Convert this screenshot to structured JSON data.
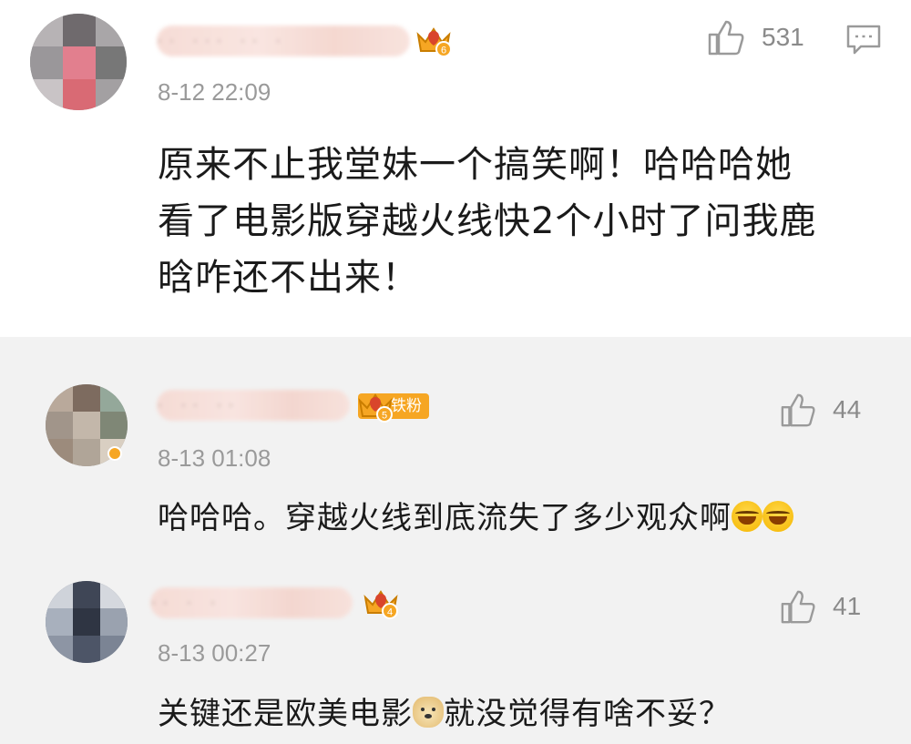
{
  "main": {
    "time": "8-12 22:09",
    "likes": "531",
    "text_lines": [
      "原来不止我堂妹一个搞笑啊！哈哈哈她",
      "看了电影版穿越火线快2个小时了问我鹿",
      "晗咋还不出来！"
    ],
    "level": "6"
  },
  "replies": [
    {
      "time": "8-13 01:08",
      "likes": "44",
      "text": "哈哈哈。穿越火线到底流失了多少观众啊",
      "level": "5",
      "badge": "铁粉"
    },
    {
      "time": "8-13 00:27",
      "likes": "41",
      "text_a": "关键还是欧美电影",
      "text_b": "就没觉得有啥不妥？",
      "level": "4"
    }
  ],
  "colors": {
    "crown": "#f6a623",
    "crown_dark": "#d9452b",
    "icon_gray": "#9a9a9a"
  },
  "icons": [
    "thumbs-up-icon",
    "comment-icon",
    "crown-icon",
    "laugh-cry-emoji",
    "doge-emoji"
  ]
}
